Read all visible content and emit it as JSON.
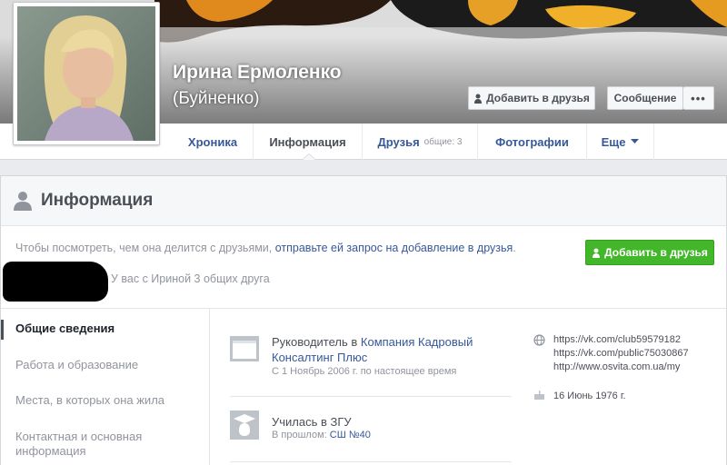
{
  "profile": {
    "name": "Ирина Ермоленко",
    "alt_name": "(Буйненко)"
  },
  "cover_buttons": {
    "add_friend": "Добавить в друзья",
    "message": "Сообщение",
    "more": "•••"
  },
  "tabs": [
    {
      "label": "Хроника",
      "sub": ""
    },
    {
      "label": "Информация",
      "sub": ""
    },
    {
      "label": "Друзья",
      "sub": "общие: 3"
    },
    {
      "label": "Фотографии",
      "sub": ""
    },
    {
      "label": "Еще",
      "sub": ""
    }
  ],
  "info": {
    "title": "Информация",
    "request_text": "Чтобы посмотреть, чем она делится с друзьями, ",
    "request_link": "отправьте ей запрос на добавление в друзья",
    "request_end": ".",
    "add_button": "Добавить в друзья",
    "mutual": "У вас с Ириной 3 общих друга"
  },
  "sidebar": {
    "items": [
      {
        "label": "Общие сведения",
        "active": true
      },
      {
        "label": "Работа и образование",
        "active": false
      },
      {
        "label": "Места, в которых она жила",
        "active": false
      },
      {
        "label": "Контактная и основная информация",
        "active": false
      }
    ]
  },
  "entries": {
    "work": {
      "prefix": "Руководитель в ",
      "company": "Компания Кадровый Консалтинг Плюс",
      "dates": "С 1 Ноябрь 2006 г. по настоящее время"
    },
    "edu": {
      "title": "Училась в ЗГУ",
      "sub_prefix": "В прошлом: ",
      "sub_link": "СШ №40"
    }
  },
  "contacts": {
    "links": [
      "https://vk.com/club59579182",
      "https://vk.com/public75030867",
      "http://www.osvita.com.ua/my"
    ],
    "birthday": "16 Июнь 1976 г."
  },
  "colors": {
    "link": "#365899",
    "green_button": "#42b72a",
    "text_dark": "#4b4f56",
    "text_muted": "#90949c"
  }
}
